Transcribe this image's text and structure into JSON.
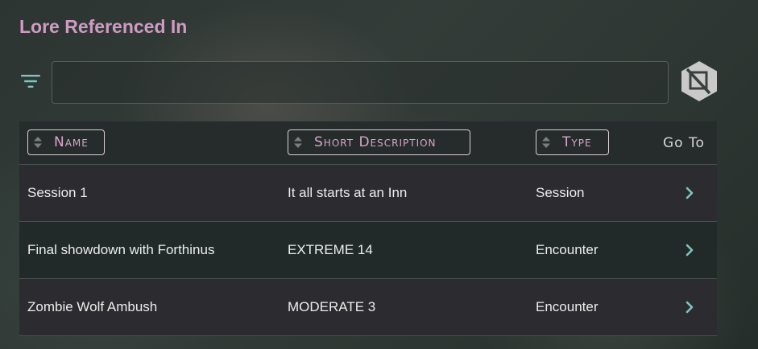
{
  "section": {
    "title": "Lore Referenced In"
  },
  "filter": {
    "value": "",
    "placeholder": ""
  },
  "table": {
    "headers": {
      "name": "Name",
      "short_description": "Short Description",
      "type": "Type",
      "go_to": "Go To"
    },
    "rows": [
      {
        "name": "Session 1",
        "short_description": "It all starts at an Inn",
        "type": "Session"
      },
      {
        "name": "Final showdown with Forthinus",
        "short_description": "EXTREME 14",
        "type": "Encounter"
      },
      {
        "name": "Zombie Wolf Ambush",
        "short_description": "MODERATE 3",
        "type": "Encounter"
      }
    ]
  },
  "colors": {
    "accent": "#cf9bc3",
    "icon_teal": "#7fc4c0",
    "row_dark": "#2b2b30",
    "row_teal": "#222a29"
  },
  "icons": {
    "filter": "filter-lines-icon",
    "toggle": "hexagon-square-slash-icon",
    "sort": "sort-up-down-icon",
    "go": "chevron-right-icon"
  }
}
